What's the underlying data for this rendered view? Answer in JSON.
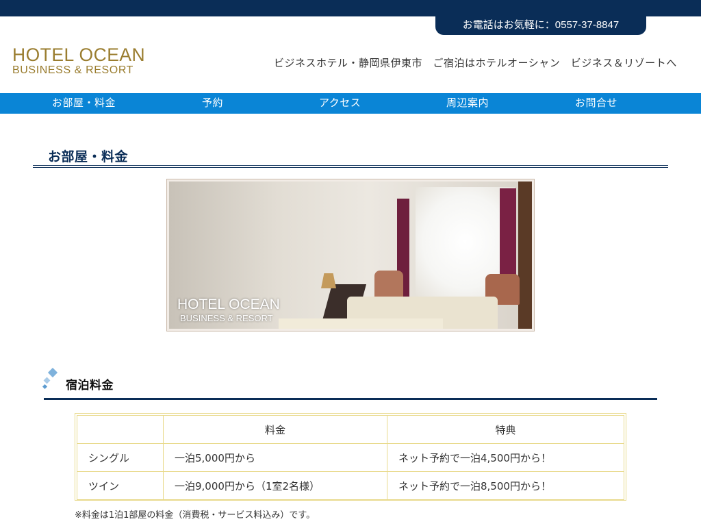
{
  "header": {
    "phone_text": "お電話はお気軽に：0557-37-8847",
    "logo_main": "HOTEL OCEAN",
    "logo_sub": "BUSINESS & RESORT",
    "tagline": "ビジネスホテル・静岡県伊東市　ご宿泊はホテルオーシャン　ビジネス＆リゾートへ"
  },
  "nav": {
    "items": [
      {
        "label": "お部屋・料金"
      },
      {
        "label": "予約"
      },
      {
        "label": "アクセス"
      },
      {
        "label": "周辺案内"
      },
      {
        "label": "お問合せ"
      }
    ]
  },
  "main": {
    "page_title": "お部屋・料金",
    "hero_caption_main": "HOTEL OCEAN",
    "hero_caption_sub": "BUSINESS & RESORT",
    "section_title": "宿泊料金",
    "table": {
      "headers": [
        "",
        "料金",
        "特典"
      ],
      "rows": [
        [
          "シングル",
          "一泊5,000円から",
          "ネット予約で一泊4,500円から！"
        ],
        [
          "ツイン",
          "一泊9,000円から（1室2名様）",
          "ネット予約で一泊8,500円から！"
        ]
      ]
    },
    "note": "※料金は1泊1部屋の料金（消費税・サービス料込み）です。"
  },
  "colors": {
    "navy": "#0a2d57",
    "nav_blue": "#0a85d6",
    "logo_gold": "#9a7d2f",
    "table_border": "#e8d98a"
  },
  "icons": {
    "section_icon": "diamond-squares-icon",
    "hero_image": "hotel-room-photo"
  }
}
